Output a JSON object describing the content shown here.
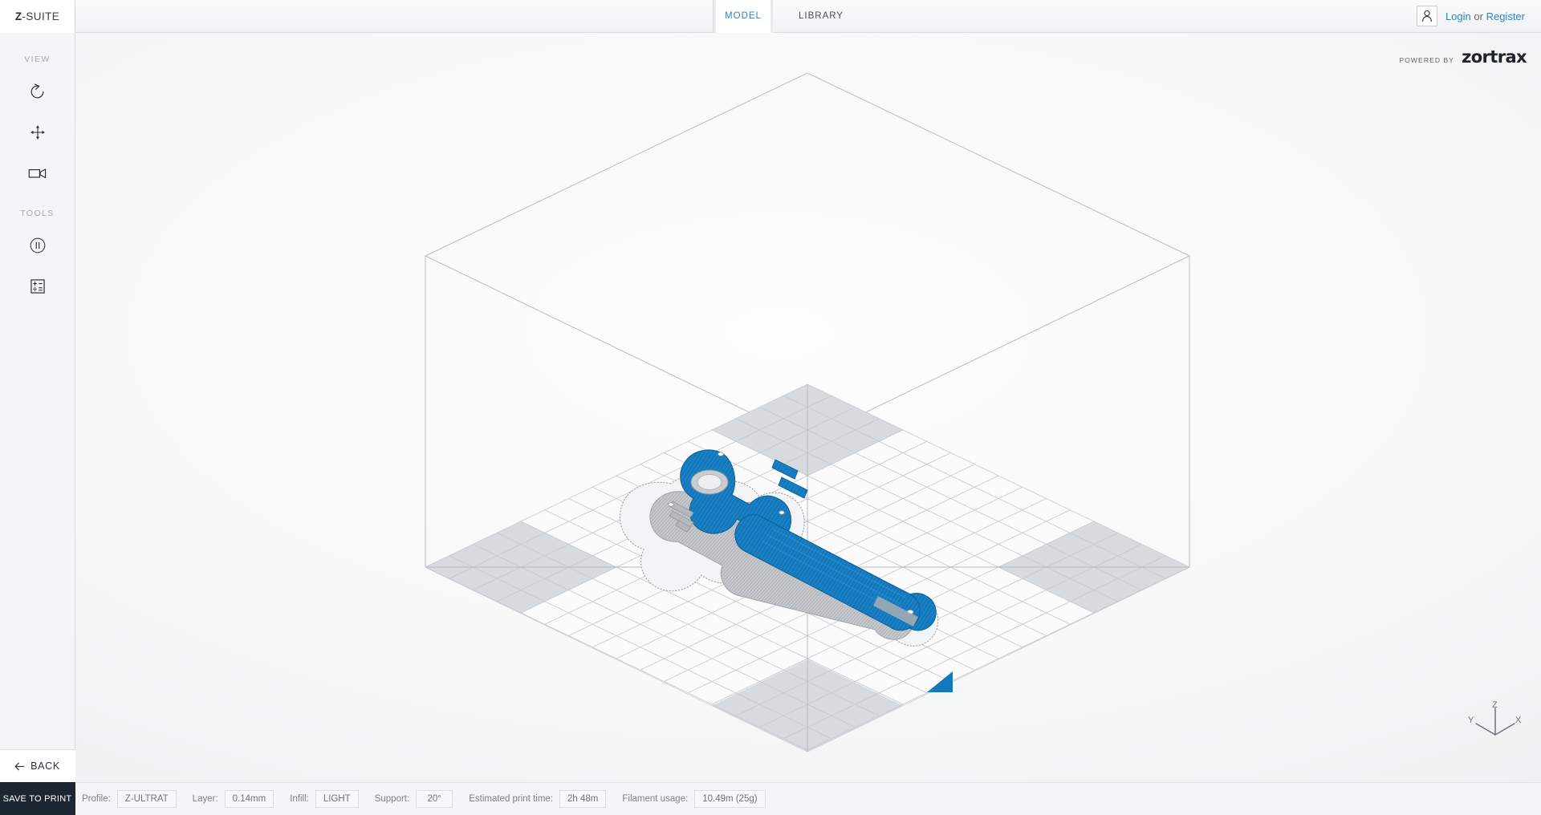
{
  "app": {
    "brand_prefix": "Z",
    "brand_suffix": "-SUITE"
  },
  "header": {
    "tabs": [
      {
        "label": "MODEL",
        "active": true
      },
      {
        "label": "LIBRARY",
        "active": false
      }
    ],
    "account": {
      "icon": "user-icon",
      "login_label": "Login",
      "separator": "or",
      "register_label": "Register"
    }
  },
  "sidebar": {
    "sections": [
      {
        "label": "VIEW",
        "items": [
          {
            "icon": "rotate-ccw-icon",
            "name": "rotate-tool"
          },
          {
            "icon": "move-arrows-icon",
            "name": "move-tool"
          },
          {
            "icon": "camera-icon",
            "name": "camera-tool"
          }
        ]
      },
      {
        "label": "TOOLS",
        "items": [
          {
            "icon": "pause-circle-icon",
            "name": "pause-tool"
          },
          {
            "icon": "calculator-icon",
            "name": "calculator-tool"
          }
        ]
      }
    ],
    "back_label": "BACK",
    "save_label": "SAVE TO PRINT"
  },
  "viewport": {
    "branding": {
      "powered_by": "POWERED BY",
      "logo": "zortrax"
    },
    "axis": {
      "x": "X",
      "y": "Y",
      "z": "Z"
    },
    "model": {
      "name": "sliced-model",
      "body_color": "#1479bc",
      "support_color": "#b9bcc0"
    },
    "grid": {
      "line_color": "#c6c9cd",
      "corner_color": "#d2d5d8"
    },
    "front_marker_color": "#1479bc"
  },
  "statusbar": {
    "fields": [
      {
        "label": "Profile:",
        "value": "Z-ULTRAT",
        "name": "profile"
      },
      {
        "label": "Layer:",
        "value": "0.14mm",
        "name": "layer"
      },
      {
        "label": "Infill:",
        "value": "LIGHT",
        "name": "infill"
      },
      {
        "label": "Support:",
        "value": "20°",
        "name": "support"
      },
      {
        "label": "Estimated print time:",
        "value": "2h 48m",
        "name": "print-time"
      },
      {
        "label": "Filament usage:",
        "value": "10.49m (25g)",
        "name": "filament-usage"
      }
    ]
  }
}
